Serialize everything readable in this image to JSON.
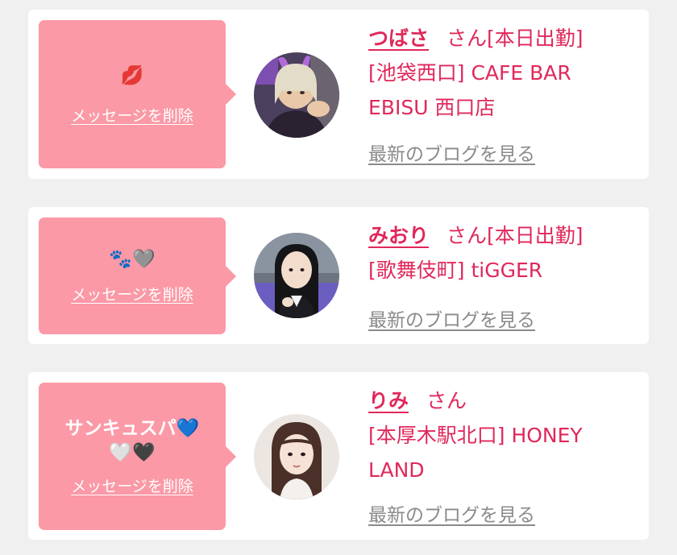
{
  "entries": [
    {
      "message": "💋",
      "delete_label": "メッセージを削除",
      "name": "つばさ",
      "honorific": "さん",
      "status": "[本日出勤]",
      "store": "[池袋西口] CAFE BAR EBISU 西口店",
      "blog_label": "最新のブログを見る",
      "avatar_icon": "girl-avatar-photo"
    },
    {
      "message": "🐾🩶",
      "delete_label": "メッセージを削除",
      "name": "みおり",
      "honorific": "さん",
      "status": "[本日出勤]",
      "store": "[歌舞伎町] tiGGER",
      "blog_label": "最新のブログを見る",
      "avatar_icon": "girl-avatar-photo"
    },
    {
      "message": "サンキュスパ💙🤍🖤",
      "delete_label": "メッセージを削除",
      "name": "りみ",
      "honorific": "さん",
      "status": "",
      "store": "[本厚木駅北口] HONEY LAND",
      "blog_label": "最新のブログを見る",
      "avatar_icon": "girl-avatar-photo"
    }
  ],
  "colors": {
    "page_background": "#f0f0f0",
    "card_background": "#ffffff",
    "bubble": "#fb99a6",
    "accent": "#e0285a",
    "link_gray": "#8a8a8a"
  }
}
